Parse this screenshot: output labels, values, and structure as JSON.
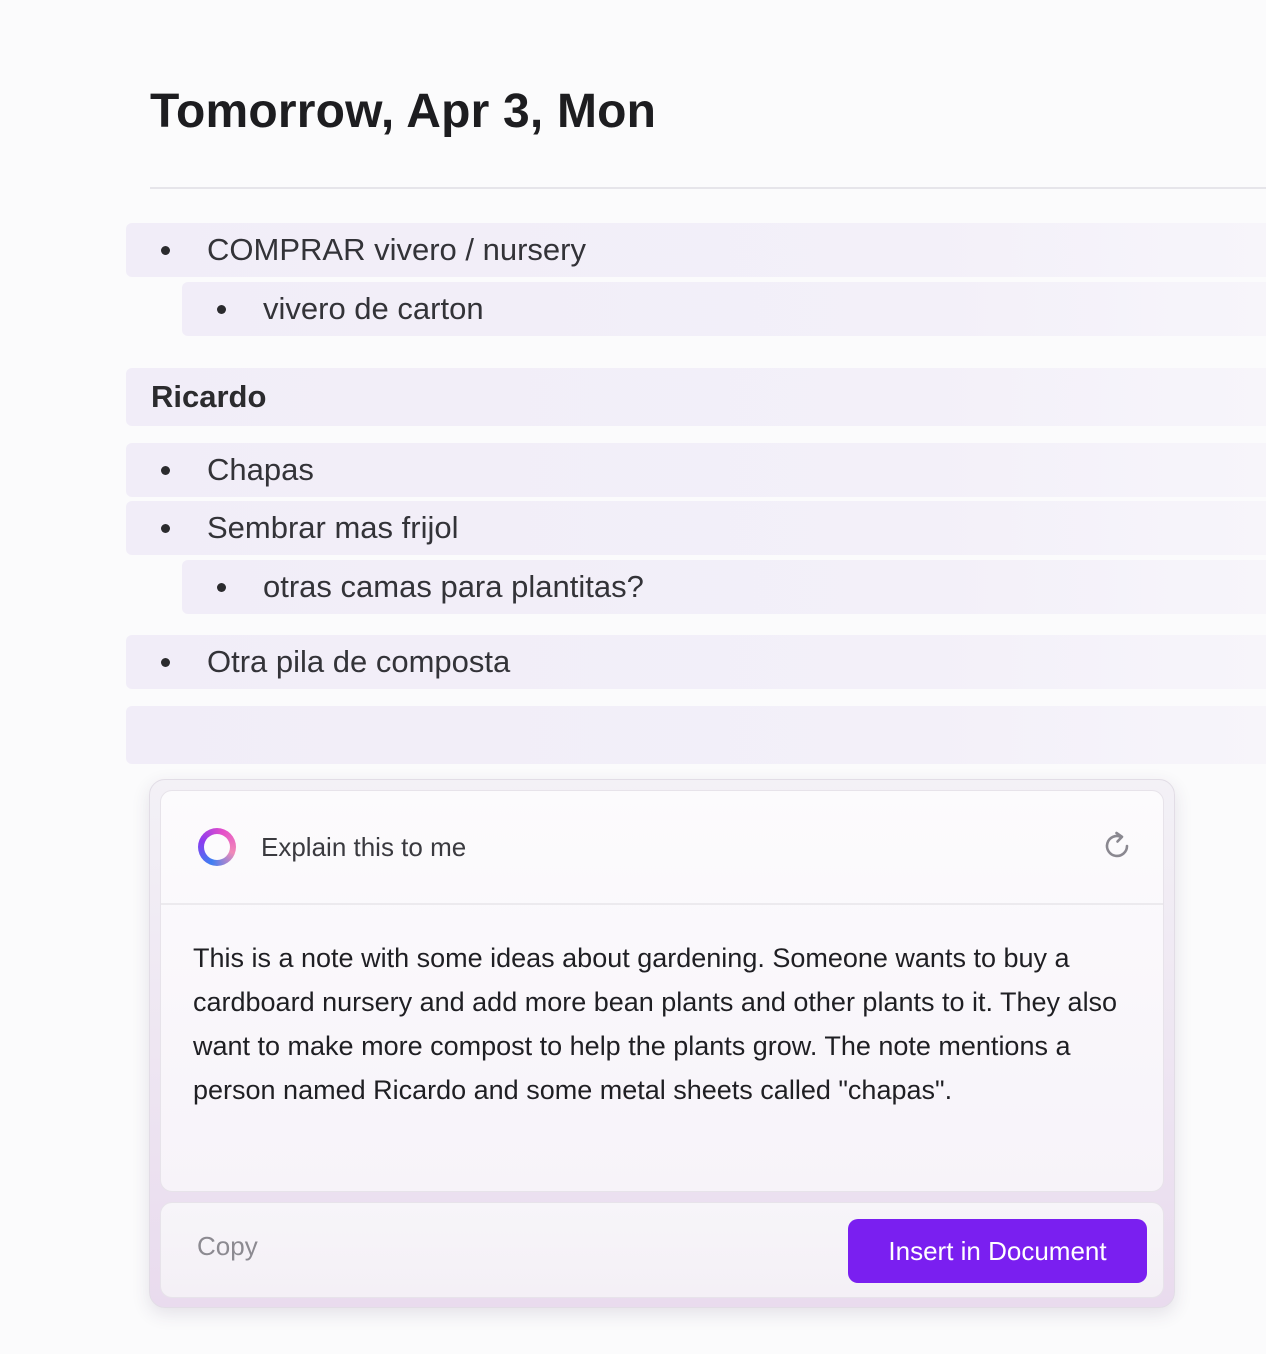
{
  "page": {
    "title": "Tomorrow, Apr 3, Mon"
  },
  "note": {
    "items": [
      {
        "text": "COMPRAR vivero / nursery"
      },
      {
        "text": "vivero de carton"
      },
      {
        "text": "Chapas"
      },
      {
        "text": "Sembrar mas frijol"
      },
      {
        "text": "otras camas para plantitas?"
      },
      {
        "text": "Otra pila de composta"
      }
    ],
    "heading": "Ricardo"
  },
  "ai_panel": {
    "prompt": "Explain this to me",
    "response": "This is a note with some ideas about gardening. Someone wants to buy a cardboard nursery and add more bean plants and other plants to it. They also want to make more compost to help the plants grow. The note mentions a person named Ricardo and some metal sheets called \"chapas\".",
    "copy_label": "Copy",
    "insert_label": "Insert in Document",
    "icons": {
      "assistant": "ai-ring-icon",
      "regenerate": "refresh-icon"
    }
  },
  "colors": {
    "accent": "#7a1ff0",
    "row_highlight": "#f1edf8"
  }
}
